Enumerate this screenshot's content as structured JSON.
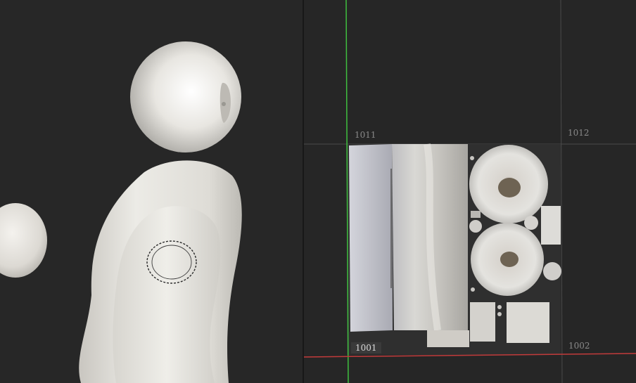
{
  "viewport3d": {
    "background": "#272727",
    "brush_cursor": "dashed-circle"
  },
  "uv_editor": {
    "background": "#262626",
    "axis_u_color": "#c23b3b",
    "axis_v_color": "#3fbf3f",
    "tiles": {
      "t1011": "1011",
      "t1012": "1012",
      "t1001": "1001",
      "t1002": "1002"
    }
  }
}
